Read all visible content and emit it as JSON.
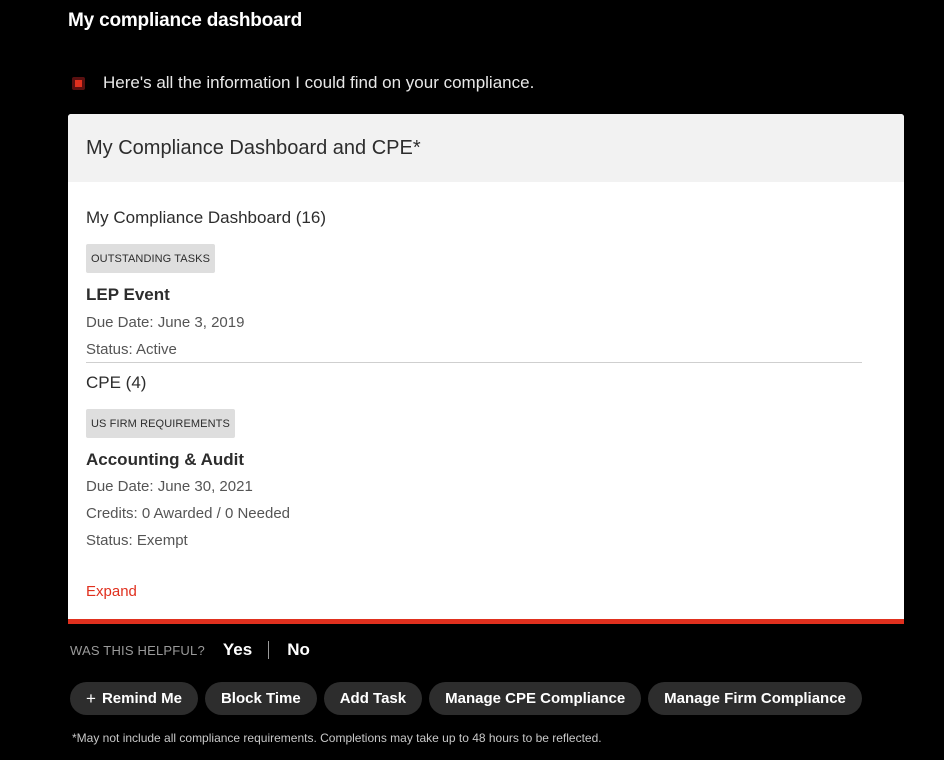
{
  "page": {
    "title": "My compliance dashboard"
  },
  "intro": {
    "text": "Here's all the information I could find on your compliance."
  },
  "card": {
    "title": "My Compliance Dashboard and CPE*",
    "dashboard": {
      "heading": "My Compliance Dashboard (16)",
      "tag": "OUTSTANDING TASKS",
      "item": {
        "title": "LEP Event",
        "due": "Due Date: June 3, 2019",
        "status": "Status: Active"
      }
    },
    "cpe": {
      "heading": "CPE (4)",
      "tag": "US FIRM REQUIREMENTS",
      "item": {
        "title": "Accounting & Audit",
        "due": "Due Date: June 30, 2021",
        "credits": "Credits: 0 Awarded / 0 Needed",
        "status": "Status: Exempt"
      }
    },
    "expand_label": "Expand"
  },
  "feedback": {
    "label": "WAS THIS HELPFUL?",
    "yes": "Yes",
    "no": "No"
  },
  "actions": {
    "remind_plus": "+",
    "remind": "Remind Me",
    "block_time": "Block Time",
    "add_task": "Add Task",
    "manage_cpe": "Manage CPE Compliance",
    "manage_firm": "Manage Firm Compliance"
  },
  "footnote": "*May not include all compliance requirements. Completions may take up to 48 hours to be reflected.",
  "colors": {
    "accent": "#e0301e",
    "background": "#000000",
    "card": "#ffffff",
    "card_header": "#f2f2f2",
    "pill": "#2d2d2d",
    "tag": "#dedede"
  },
  "icons": {
    "intro": "bot-avatar-icon",
    "remind": "plus-icon"
  }
}
